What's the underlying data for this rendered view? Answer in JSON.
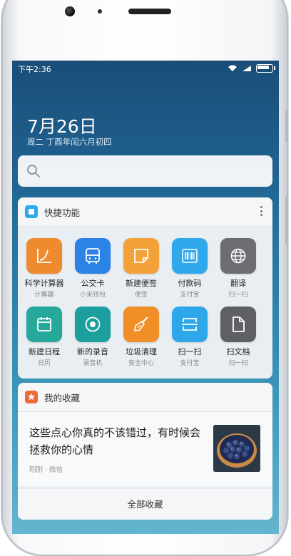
{
  "status": {
    "time": "下午2:36"
  },
  "date": {
    "big": "7月26日",
    "sub": "周二 丁酉年闰六月初四"
  },
  "search": {
    "icon": "search-icon"
  },
  "quick": {
    "title": "快捷功能",
    "apps": [
      {
        "name": "科学计算器",
        "sub": "计算器",
        "color": "#f08a2e",
        "icon": "calculator-icon"
      },
      {
        "name": "公交卡",
        "sub": "小米钱包",
        "color": "#2a84e8",
        "icon": "bus-icon"
      },
      {
        "name": "新建便签",
        "sub": "便签",
        "color": "#f3a23a",
        "icon": "note-icon"
      },
      {
        "name": "付款码",
        "sub": "支付宝",
        "color": "#2fa9ec",
        "icon": "barcode-icon"
      },
      {
        "name": "翻译",
        "sub": "扫一扫",
        "color": "#6b6d70",
        "icon": "globe-icon"
      },
      {
        "name": "新建日程",
        "sub": "日历",
        "color": "#26a89a",
        "icon": "calendar-icon"
      },
      {
        "name": "新的录音",
        "sub": "录音机",
        "color": "#1d9fa0",
        "icon": "record-icon"
      },
      {
        "name": "垃圾清理",
        "sub": "安全中心",
        "color": "#f08f28",
        "icon": "broom-icon"
      },
      {
        "name": "扫一扫",
        "sub": "支付宝",
        "color": "#2ea7ea",
        "icon": "scan-icon"
      },
      {
        "name": "扫文档",
        "sub": "扫一扫",
        "color": "#5e6063",
        "icon": "document-icon"
      }
    ]
  },
  "favorites": {
    "title": "我的收藏",
    "item_text": "这些点心你真的不该错过，有时候会拯救你的心情",
    "item_meta": "刚刚 · 微信",
    "all_label": "全部收藏"
  },
  "colors": {
    "accent": "#2a84e8",
    "fav_accent": "#ef6a3a",
    "quick_accent": "#2fa9ec"
  }
}
